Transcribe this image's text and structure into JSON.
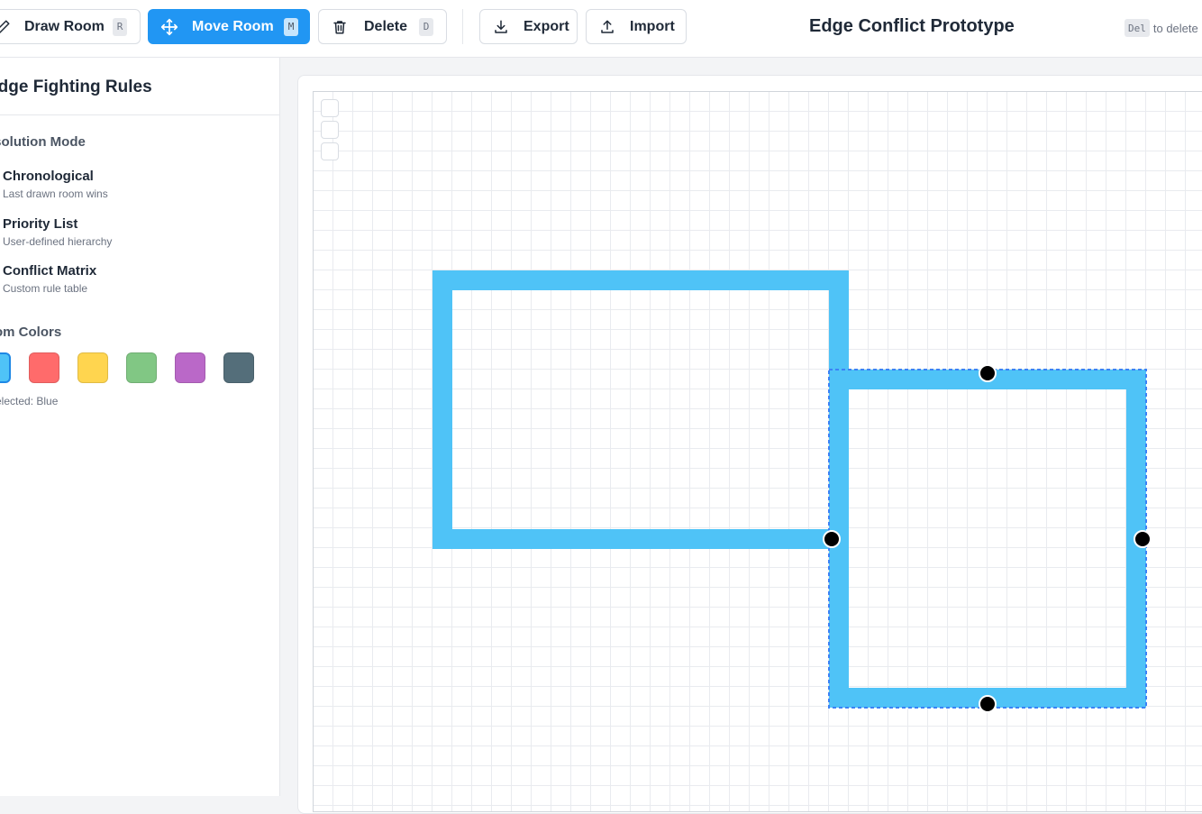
{
  "toolbar": {
    "draw": {
      "label": "Draw Room",
      "shortcut": "R",
      "icon": "pencil-icon"
    },
    "move": {
      "label": "Move Room",
      "shortcut": "M",
      "icon": "move-arrows-icon",
      "active": true
    },
    "delete": {
      "label": "Delete",
      "shortcut": "D",
      "icon": "trash-icon"
    },
    "export": {
      "label": "Export",
      "icon": "download-icon"
    },
    "import": {
      "label": "Import",
      "icon": "upload-icon"
    },
    "title": "Edge Conflict Prototype",
    "hint": {
      "key": "Del",
      "text": "to delete"
    }
  },
  "sidebar": {
    "title": "Edge Fighting Rules",
    "resolution_heading": "Resolution Mode",
    "modes": [
      {
        "name": "Chronological",
        "desc": "Last drawn room wins"
      },
      {
        "name": "Priority List",
        "desc": "User-defined hierarchy"
      },
      {
        "name": "Conflict Matrix",
        "desc": "Custom rule table"
      }
    ],
    "colors_heading": "Room Colors",
    "swatches": [
      {
        "name": "Blue",
        "hex": "#4fc3f7",
        "selected": true
      },
      {
        "name": "Red",
        "hex": "#ff6b6b"
      },
      {
        "name": "Yellow",
        "hex": "#ffd54f"
      },
      {
        "name": "Green",
        "hex": "#81c784"
      },
      {
        "name": "Purple",
        "hex": "#ba68c8"
      },
      {
        "name": "Slate",
        "hex": "#546e7a"
      }
    ],
    "selected_text": "Selected: Blue"
  },
  "colors": {
    "accent": "#2196f3",
    "room_stroke": "#4fc3f7",
    "selection_dash": "#3b82f6",
    "handle": "#000000"
  }
}
